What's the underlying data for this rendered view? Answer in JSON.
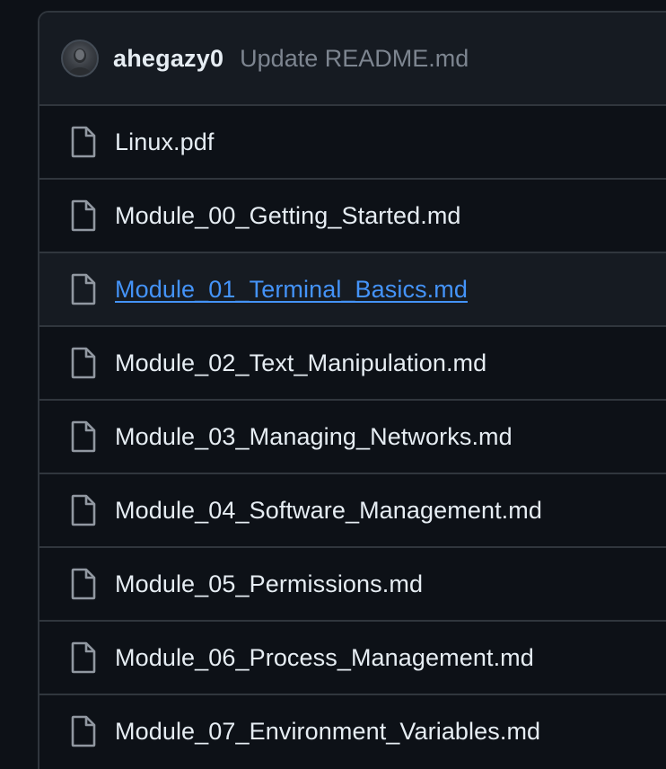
{
  "commit": {
    "author": "ahegazy0",
    "message": "Update README.md"
  },
  "files": [
    {
      "name": "Linux.pdf",
      "icon": "file-icon"
    },
    {
      "name": "Module_00_Getting_Started.md",
      "icon": "file-icon"
    },
    {
      "name": "Module_01_Terminal_Basics.md",
      "icon": "file-icon",
      "hovered": true
    },
    {
      "name": "Module_02_Text_Manipulation.md",
      "icon": "file-icon"
    },
    {
      "name": "Module_03_Managing_Networks.md",
      "icon": "file-icon"
    },
    {
      "name": "Module_04_Software_Management.md",
      "icon": "file-icon"
    },
    {
      "name": "Module_05_Permissions.md",
      "icon": "file-icon"
    },
    {
      "name": "Module_06_Process_Management.md",
      "icon": "file-icon"
    },
    {
      "name": "Module_07_Environment_Variables.md",
      "icon": "file-icon"
    }
  ],
  "colors": {
    "background": "#0d1117",
    "header_background": "#161b22",
    "border": "#30363d",
    "text": "#e6edf3",
    "muted_text": "#7d8590",
    "link": "#4493f8"
  }
}
